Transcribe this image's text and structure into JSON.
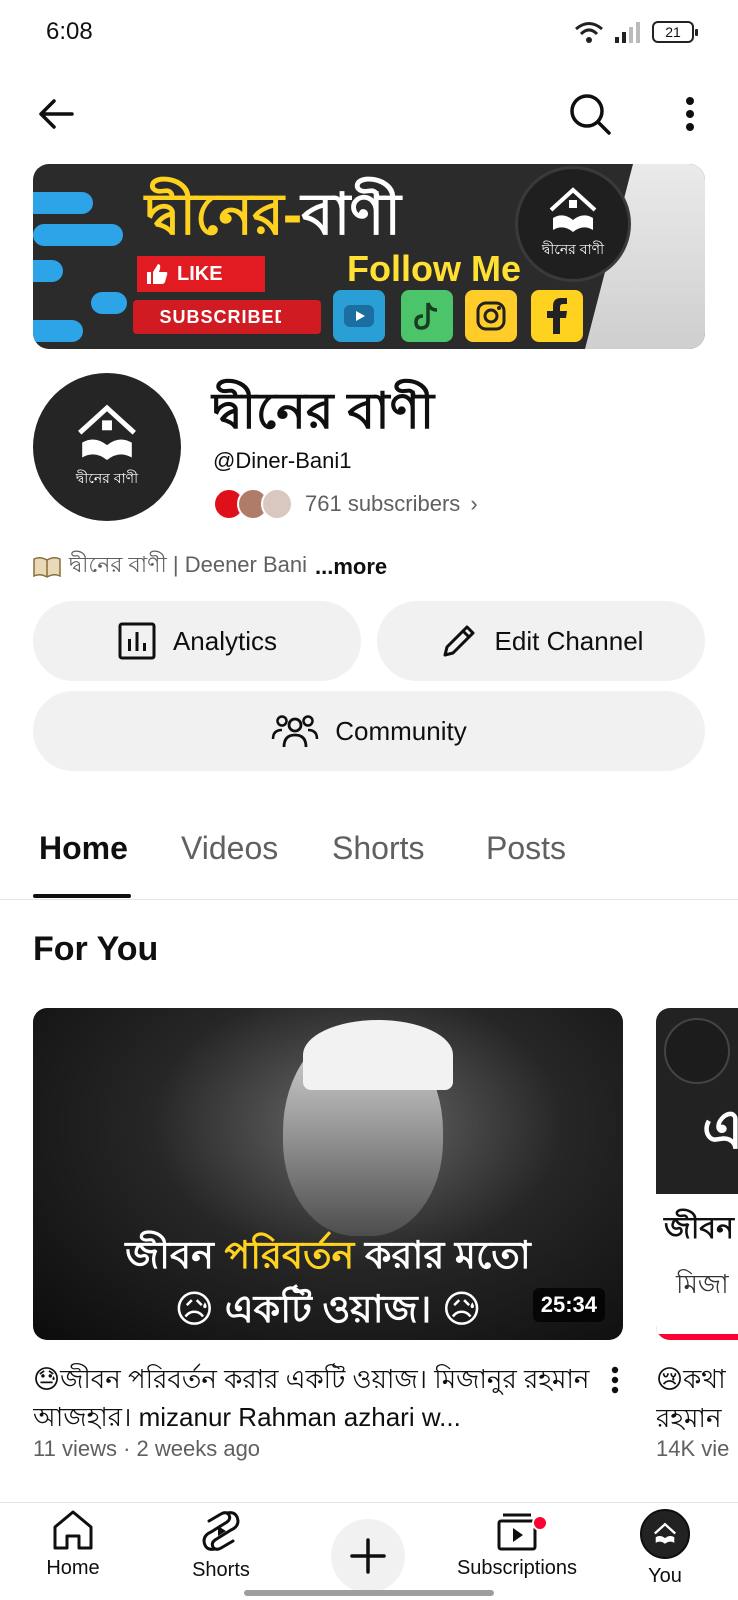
{
  "status_bar": {
    "time": "6:08",
    "battery": "21"
  },
  "banner": {
    "title_part1": "দ্বীনের-",
    "title_part2": "বাণী",
    "like": "LIKE",
    "subscribed": "SUBSCRIBED",
    "follow": "Follow Me",
    "logo_caption": "দ্বীনের বাণী"
  },
  "channel": {
    "name": "দ্বীনের বাণী",
    "handle": "@Diner-Bani1",
    "subscribers": "761 subscribers",
    "description": "দ্বীনের বাণী | Deener Bani",
    "more": "...more",
    "avatar_caption": "দ্বীনের বাণী"
  },
  "actions": {
    "analytics": "Analytics",
    "edit_channel": "Edit Channel",
    "community": "Community"
  },
  "tabs": [
    {
      "label": "Home",
      "active": true
    },
    {
      "label": "Videos",
      "active": false
    },
    {
      "label": "Shorts",
      "active": false
    },
    {
      "label": "Posts",
      "active": false
    }
  ],
  "section": {
    "title": "For You"
  },
  "videos": [
    {
      "thumb_line1_a": "জীবন ",
      "thumb_line1_b": "পরিবর্তন",
      "thumb_line1_c": " করার মতো",
      "thumb_line2": "😥 একটি ওয়াজ। 😥",
      "duration": "25:34",
      "title": "😓জীবন পরিবর্তন করার একটি ওয়াজ। মিজানুর রহমান আজহার। mizanur Rahman azhari w...",
      "meta": "11 views · 2 weeks ago"
    },
    {
      "thumb_big": "এ",
      "thumb_text1": "জীবন",
      "thumb_text2": "মিজা",
      "title_line1": "😢কথা",
      "title_line2": "রহমান",
      "meta": "14K vie"
    }
  ],
  "bottom_nav": {
    "home": "Home",
    "shorts": "Shorts",
    "subscriptions": "Subscriptions",
    "you": "You"
  },
  "colors": {
    "accent_red": "#ff0033",
    "banner_yellow": "#ffd21f",
    "banner_bg": "#2b2b2b"
  }
}
